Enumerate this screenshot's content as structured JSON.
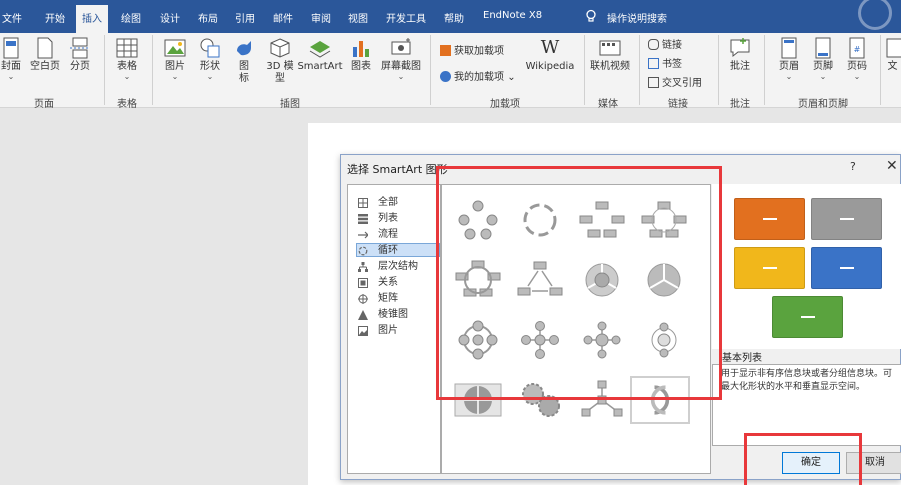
{
  "tabs": [
    "文件",
    "开始",
    "插入",
    "绘图",
    "设计",
    "布局",
    "引用",
    "邮件",
    "审阅",
    "视图",
    "开发工具",
    "帮助",
    "EndNote X8"
  ],
  "tell_me": "操作说明搜索",
  "ribbon": {
    "pages": {
      "cover": "封面",
      "blank": "空白页",
      "break": "分页",
      "group": "页面"
    },
    "tables": {
      "table": "表格",
      "group": "表格"
    },
    "illustrations": {
      "picture": "图片",
      "shapes": "形状",
      "icons_l1": "图",
      "icons_l2": "标",
      "model_l1": "3D 模",
      "model_l2": "型",
      "smartart": "SmartArt",
      "chart": "图表",
      "screenshot": "屏幕截图",
      "group": "插图"
    },
    "addins": {
      "get": "获取加载项",
      "my": "我的加载项",
      "wiki": "Wikipedia",
      "group": "加载项"
    },
    "media": {
      "online_video": "联机视频",
      "group": "媒体"
    },
    "links": {
      "link": "链接",
      "bookmark": "书签",
      "cross_ref": "交叉引用",
      "group": "链接"
    },
    "comments": {
      "comment": "批注",
      "group": "批注"
    },
    "header_footer": {
      "header": "页眉",
      "footer": "页脚",
      "page_num": "页码",
      "group": "页眉和页脚"
    },
    "text_partial": "文"
  },
  "dialog": {
    "title": "选择 SmartArt 图形",
    "help": "?",
    "close": "✕",
    "categories": [
      "全部",
      "列表",
      "流程",
      "循环",
      "层次结构",
      "关系",
      "矩阵",
      "棱锥图",
      "图片"
    ],
    "selected_category": "循环",
    "description_title": "基本列表",
    "description_text": "用于显示非有序信息块或者分组信息块。可最大化形状的水平和垂直显示空间。",
    "ok": "确定",
    "cancel": "取消"
  },
  "colors": {
    "title_bar": "#2b579a",
    "annotation_red": "#e8383b",
    "preview_orange": "#e2701f",
    "preview_gray": "#9a9a9a",
    "preview_yellow": "#f1b71b",
    "preview_blue": "#3a73c7",
    "preview_green": "#5aa33e"
  }
}
